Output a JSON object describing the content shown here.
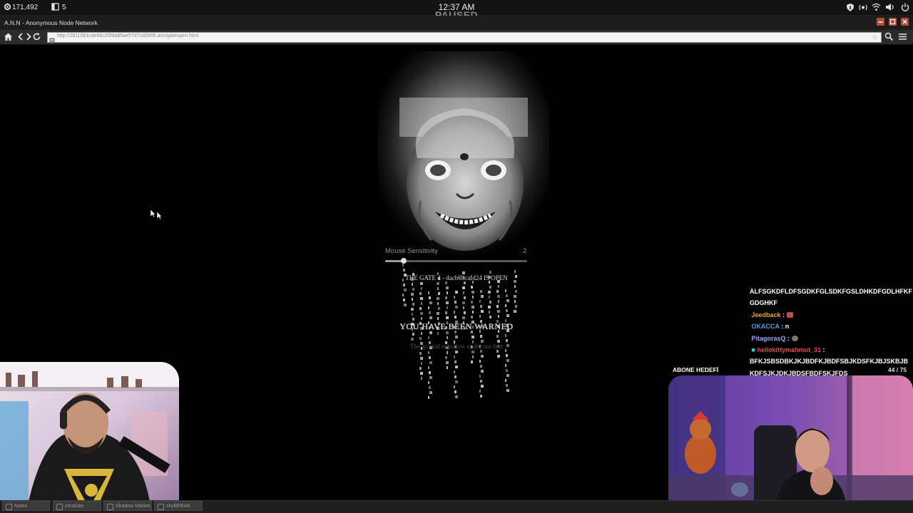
{
  "system_bar": {
    "left_value": "171,492",
    "left_count": "5",
    "clock": "12:37 AM",
    "status": "PAUSED"
  },
  "browser": {
    "window_title": "A.N.N - Anonymous Node Network",
    "url": "http://28110b1cde66c2f39a66ae57d7cd3906.ann/gateopen.html"
  },
  "page": {
    "sensitivity_label": "Mouse Sensitivity",
    "sensitivity_value": "2",
    "sensitivity_level": 0.13,
    "gate_line": "THE GATE 4 - dacb69cafd24 IS OPEN",
    "warning": "YOU HAVE BEEN WARNED",
    "ground": "The ground is hollow under our feet"
  },
  "chat": {
    "messages": [
      {
        "user": "",
        "text": "ALFSGKDFLDFSGDKFGLSDKFGSLDHKDFGDLHFKF"
      },
      {
        "user": "",
        "text": "GDGHKF"
      },
      {
        "user": "Jeedback",
        "text": ""
      },
      {
        "user": "OKACCA",
        "text": "n"
      },
      {
        "user": "PitagorasQ",
        "text": ""
      },
      {
        "user": "hellokittymahmut_31",
        "text": ""
      },
      {
        "user": "",
        "text": "BFKJSBSDBKJKJBDFKJBDFSBJKDSFKJBJSKBJB"
      },
      {
        "user": "",
        "text": "KDFSJKJDKJBDSFBDFSKJFDS"
      }
    ]
  },
  "sub_goal": {
    "label": "ABONE HEDEFİ",
    "count": "44 / 75"
  },
  "taskbar": {
    "items": [
      "Notes",
      "zeroDay",
      "Shadow Market",
      "skyBREAK"
    ]
  },
  "colors": {
    "window_button": "#b84a34",
    "chat_orange": "#e8a23a",
    "chat_blue": "#4d9fe0",
    "chat_red": "#e04a4a"
  }
}
